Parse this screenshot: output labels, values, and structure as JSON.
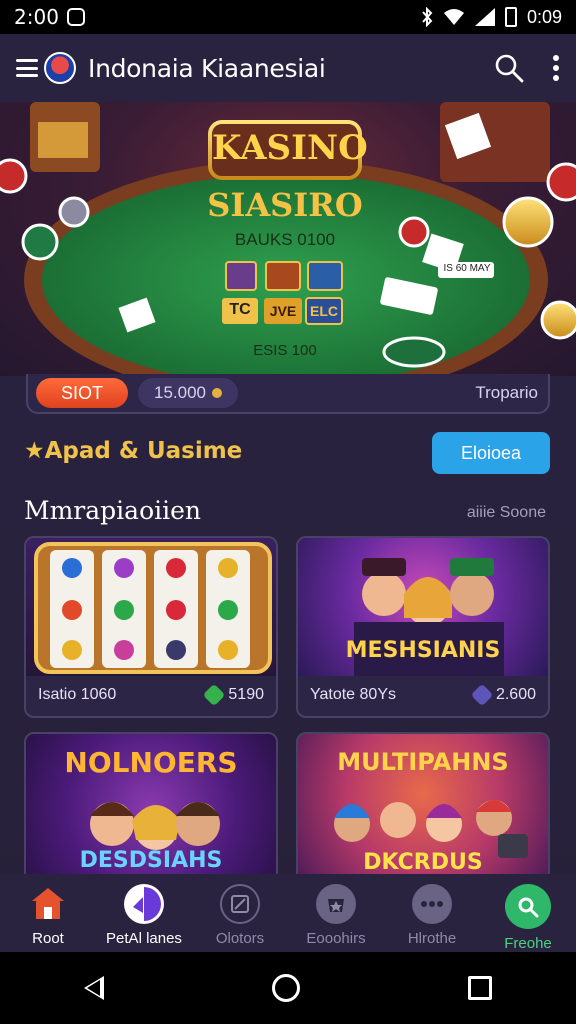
{
  "status_bar": {
    "time": "2:00",
    "right_text": "0:09",
    "icons": [
      "notification-icon",
      "bluetooth-icon",
      "wifi-icon",
      "signal-icon",
      "battery-icon"
    ]
  },
  "app_bar": {
    "title": "Indonaia Kiaanesiai",
    "icons": [
      "menu-icon",
      "app-logo",
      "search-icon",
      "more-vert-icon"
    ]
  },
  "hero": {
    "logo_text": "KASINO",
    "headline": "SIASIRO",
    "subline": "BAUKS 0100",
    "tile_labels": [
      "TC",
      "JVE",
      "ELC"
    ],
    "sign_text": "IS 60 MAY",
    "footer_text": "ESIS 100"
  },
  "bonus_strip": {
    "slot_label": "SIOT",
    "coins_label": "15.000",
    "right_label": "Tropario"
  },
  "section": {
    "title": "★Apad & Uasime",
    "button_label": "Eloioea",
    "subtitle": "Mmrapiaoiien",
    "link_label": "aiiie Soone"
  },
  "games": [
    {
      "label": "",
      "footer_left": "Isatio 1060",
      "footer_value": "5190",
      "gem_color": "#35b24a"
    },
    {
      "label": "MESHSIANIS",
      "footer_left": "Yatote 80Ys",
      "footer_value": "2.600",
      "gem_color": "#5d56b8"
    },
    {
      "label_top": "NOLNOERS",
      "label_bottom": "DESDSIAHS"
    },
    {
      "label_top": "MULTIPAHNS",
      "label_bottom": "DKCRDUS"
    }
  ],
  "bottom_nav": {
    "items": [
      {
        "label": "Root",
        "icon": "home-icon"
      },
      {
        "label": "PetAl lanes",
        "icon": "games-icon"
      },
      {
        "label": "Olotors",
        "icon": "tools-icon"
      },
      {
        "label": "Eooohirs",
        "icon": "shop-icon"
      },
      {
        "label": "Hlrothe",
        "icon": "more-icon"
      },
      {
        "label": "Freohe",
        "icon": "phone-icon"
      }
    ]
  },
  "colors": {
    "background": "#2a2340",
    "accent_gold": "#f1c24a",
    "accent_blue": "#2ba3e8",
    "accent_green": "#49d47c",
    "pill_orange": "#e0431f"
  }
}
